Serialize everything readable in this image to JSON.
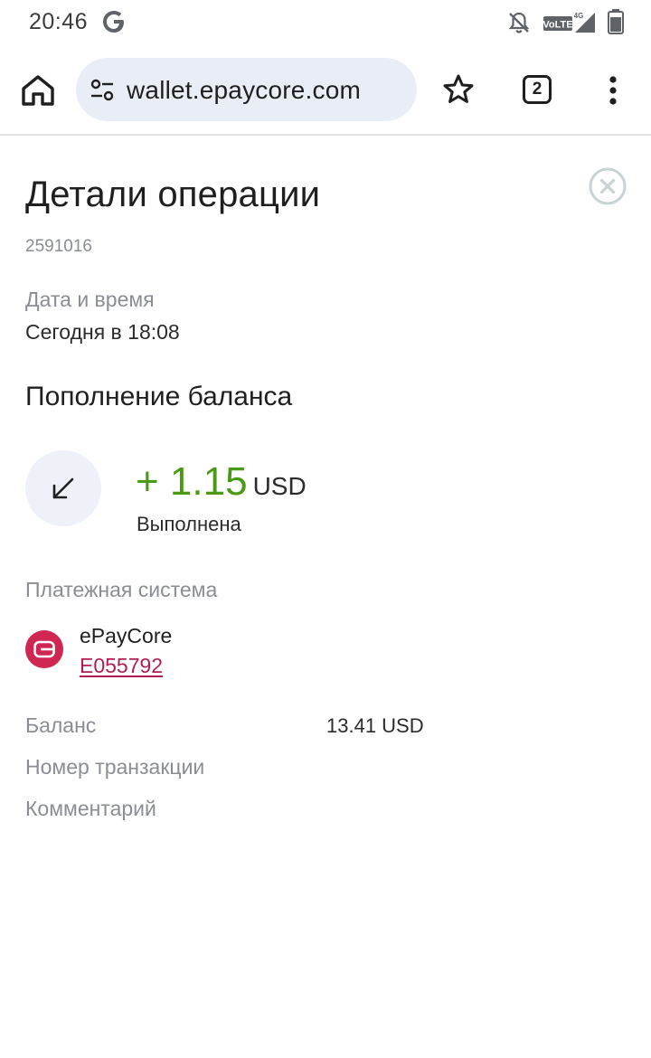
{
  "status_bar": {
    "time": "20:46",
    "icons": [
      "google-g-icon",
      "bell-off-icon",
      "volte-4g-signal-icon",
      "battery-icon"
    ],
    "network_label": "VoLTE",
    "network_type": "4G"
  },
  "browser": {
    "url": "wallet.epaycore.com",
    "tab_count": "2"
  },
  "operation": {
    "title": "Детали операции",
    "id": "2591016",
    "date_label": "Дата и время",
    "date_value": "Сегодня в 18:08",
    "type": "Пополнение баланса",
    "amount": "+ 1.15",
    "currency": "USD",
    "status": "Выполнена"
  },
  "payment_system": {
    "label": "Платежная система",
    "name": "ePayCore",
    "account": "E055792"
  },
  "details": {
    "balance_label": "Баланс",
    "balance_value": "13.41 USD",
    "transaction_label": "Номер транзакции",
    "comment_label": "Комментарий"
  },
  "colors": {
    "amount_green": "#4b9a16",
    "brand_red": "#d02652",
    "link_color": "#b01e55",
    "muted_text": "#8a8d94",
    "url_bar_bg": "#e9eef6"
  }
}
